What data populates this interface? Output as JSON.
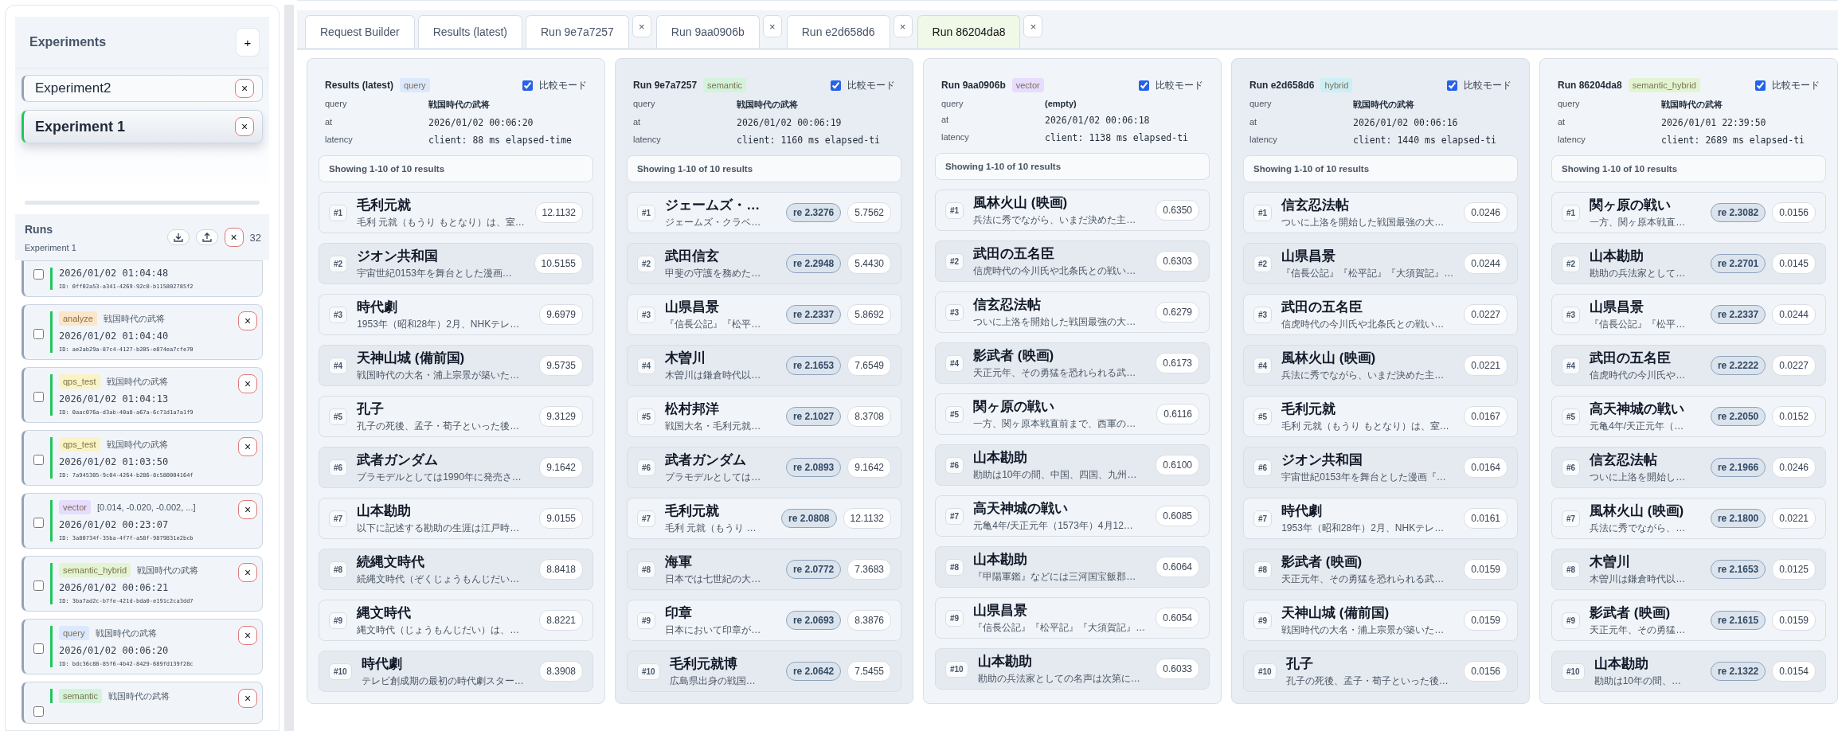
{
  "sidebar": {
    "experiments": {
      "title": "Experiments",
      "add": "+",
      "items": [
        {
          "name": "Experiment2",
          "selected": false,
          "close": "×"
        },
        {
          "name": "Experiment 1",
          "selected": true,
          "close": "×"
        }
      ]
    },
    "runs": {
      "title": "Runs",
      "subtitle": "Experiment 1",
      "close": "×",
      "count": "32",
      "items": [
        {
          "checked": false,
          "date": "2026/01/02 01:04:48",
          "id": "ID: 0ff02a53-a341-4269-92c0-b115802785f2"
        },
        {
          "checked": false,
          "tag": {
            "label": "analyze",
            "color": "#fce5c8"
          },
          "query": "戦国時代の武将",
          "date": "2026/01/02 01:04:40",
          "id": "ID: ae2ab29a-87c4-4127-b205-e874ea7cfe70",
          "close": "×"
        },
        {
          "checked": false,
          "tag": {
            "label": "qps_test",
            "color": "#f9f3c5"
          },
          "query": "戦国時代の武将",
          "date": "2026/01/02 01:04:13",
          "id": "ID: 0aac076a-d3ab-40a8-a67a-6c71d1a7a1f9",
          "close": "×"
        },
        {
          "checked": false,
          "tag": {
            "label": "qps_test",
            "color": "#f9f3c5"
          },
          "query": "戦国時代の武将",
          "date": "2026/01/02 01:03:50",
          "id": "ID: 7a945305-9c04-4264-b286-8c580004164f",
          "close": "×"
        },
        {
          "checked": false,
          "tag": {
            "label": "vector",
            "color": "#e6dcfd"
          },
          "query": "[0.014, -0.020, -0.002, ...]",
          "date": "2026/01/02 00:23:07",
          "id": "ID: 3a80734f-35ba-4f7f-a58f-9879831e2bcb",
          "close": "×"
        },
        {
          "checked": false,
          "tag": {
            "label": "semantic_hybrid",
            "color": "#e3f4d3"
          },
          "query": "戦国時代の武将",
          "date": "2026/01/02 00:06:21",
          "id": "ID: 3ba7ad2c-b7fe-421d-bda0-e191c2ca3dd7",
          "close": "×"
        },
        {
          "checked": false,
          "tag": {
            "label": "query",
            "color": "#dce8fd"
          },
          "query": "戦国時代の武将",
          "date": "2026/01/02 00:06:20",
          "id": "ID: bdc36c88-85f6-4b42-8429-689fd139f28c",
          "close": "×"
        },
        {
          "checked": false,
          "tag": {
            "label": "semantic",
            "color": "#d4f2dc"
          },
          "query": "戦国時代の武将",
          "close": "×"
        }
      ]
    }
  },
  "tabs": [
    {
      "label": "Request Builder",
      "selected": false
    },
    {
      "label": "Results (latest)",
      "selected": false
    },
    {
      "label": "Run 9e7a7257",
      "selected": false,
      "close": "×"
    },
    {
      "label": "Run 9aa0906b",
      "selected": false,
      "close": "×"
    },
    {
      "label": "Run e2d658d6",
      "selected": false,
      "close": "×"
    },
    {
      "label": "Run 86204da8",
      "selected": true,
      "close": "×"
    }
  ],
  "panels": [
    {
      "title": "Results (latest)",
      "tag": {
        "label": "query",
        "color": "#dce8fd"
      },
      "compare": {
        "label": "比較モード",
        "checked": true
      },
      "fields": [
        {
          "label": "query",
          "value": "戦国時代の武将",
          "kind": "text"
        },
        {
          "label": "at",
          "value": "2026/01/02 00:06:20",
          "kind": "mono"
        },
        {
          "label": "latency",
          "value": "client: 88 ms  elapsed-time",
          "kind": "mono"
        }
      ],
      "summary": "Showing 1-10 of 10 results",
      "results": [
        {
          "rank": "#1",
          "title": "毛利元就",
          "snippet": "毛利 元就（もうり もとなり）は、室…",
          "score": "12.1132"
        },
        {
          "rank": "#2",
          "title": "ジオン共和国",
          "snippet": "宇宙世紀0153年を舞台とした漫画…",
          "score": "10.5155"
        },
        {
          "rank": "#3",
          "title": "時代劇",
          "snippet": "1953年（昭和28年）2月、NHKテレ…",
          "score": "9.6979"
        },
        {
          "rank": "#4",
          "title": "天神山城 (備前国)",
          "snippet": "戦国時代の大名・浦上宗景が築いた…",
          "score": "9.5735"
        },
        {
          "rank": "#5",
          "title": "孔子",
          "snippet": "孔子の死後、孟子・荀子といった後…",
          "score": "9.3129"
        },
        {
          "rank": "#6",
          "title": "武者ガンダム",
          "snippet": "プラモデルとしては1990年に発売さ…",
          "score": "9.1642"
        },
        {
          "rank": "#7",
          "title": "山本勘助",
          "snippet": "以下に記述する勘助の生涯は江戸時…",
          "score": "9.0155"
        },
        {
          "rank": "#8",
          "title": "続縄文時代",
          "snippet": "続縄文時代（ぞくじょうもんじだい…",
          "score": "8.8418"
        },
        {
          "rank": "#9",
          "title": "縄文時代",
          "snippet": "縄文時代（じょうもんじだい）は、…",
          "score": "8.8221"
        },
        {
          "rank": "#10",
          "title": "時代劇",
          "snippet": "テレビ創成期の最初の時代劇スター…",
          "score": "8.3908"
        }
      ]
    },
    {
      "title": "Run 9e7a7257",
      "tag": {
        "label": "semantic",
        "color": "#d4f2dc"
      },
      "compare": {
        "label": "比較モード",
        "checked": true
      },
      "fields": [
        {
          "label": "query",
          "value": "戦国時代の武将",
          "kind": "text"
        },
        {
          "label": "at",
          "value": "2026/01/02 00:06:19",
          "kind": "mono"
        },
        {
          "label": "latency",
          "value": "client: 1160 ms  elapsed-ti",
          "kind": "mono"
        }
      ],
      "summary": "Showing 1-10 of 10 results",
      "results": [
        {
          "rank": "#1",
          "title": "ジェームズ・…",
          "snippet": "ジェームズ・クラベ…",
          "rerank": "re 2.3276",
          "score": "5.7562"
        },
        {
          "rank": "#2",
          "title": "武田信玄",
          "snippet": "甲斐の守護を務めた…",
          "rerank": "re 2.2948",
          "score": "5.4430"
        },
        {
          "rank": "#3",
          "title": "山県昌景",
          "snippet": "『信長公記』『松平…",
          "rerank": "re 2.2337",
          "score": "5.8692"
        },
        {
          "rank": "#4",
          "title": "木曽川",
          "snippet": "木曽川は鎌倉時代以…",
          "rerank": "re 2.1653",
          "score": "7.6549"
        },
        {
          "rank": "#5",
          "title": "松村邦洋",
          "snippet": "戦国大名・毛利元就…",
          "rerank": "re 2.1027",
          "score": "8.3708"
        },
        {
          "rank": "#6",
          "title": "武者ガンダム",
          "snippet": "プラモデルとしては…",
          "rerank": "re 2.0893",
          "score": "9.1642"
        },
        {
          "rank": "#7",
          "title": "毛利元就",
          "snippet": "毛利 元就（もうり …",
          "rerank": "re 2.0808",
          "score": "12.1132"
        },
        {
          "rank": "#8",
          "title": "海軍",
          "snippet": "日本では七世紀の大…",
          "rerank": "re 2.0772",
          "score": "7.3683"
        },
        {
          "rank": "#9",
          "title": "印章",
          "snippet": "日本において印章が…",
          "rerank": "re 2.0693",
          "score": "8.3876"
        },
        {
          "rank": "#10",
          "title": "毛利元就博",
          "snippet": "広島県出身の戦国…",
          "rerank": "re 2.0642",
          "score": "7.5455"
        }
      ]
    },
    {
      "title": "Run 9aa0906b",
      "tag": {
        "label": "vector",
        "color": "#e6dcfd"
      },
      "compare": {
        "label": "比較モード",
        "checked": true
      },
      "fields": [
        {
          "label": "query",
          "value": "(empty)",
          "kind": "text"
        },
        {
          "label": "at",
          "value": "2026/01/02 00:06:18",
          "kind": "mono"
        },
        {
          "label": "latency",
          "value": "client: 1138 ms  elapsed-ti",
          "kind": "mono"
        }
      ],
      "summary": "Showing 1-10 of 10 results",
      "results": [
        {
          "rank": "#1",
          "title": "風林火山 (映画)",
          "snippet": "兵法に秀でながら、いまだ決めた主…",
          "score": "0.6350"
        },
        {
          "rank": "#2",
          "title": "武田の五名臣",
          "snippet": "信虎時代の今川氏や北条氏との戦い…",
          "score": "0.6303"
        },
        {
          "rank": "#3",
          "title": "信玄忍法帖",
          "snippet": "ついに上洛を開始した戦国最強の大…",
          "score": "0.6279"
        },
        {
          "rank": "#4",
          "title": "影武者 (映画)",
          "snippet": "天正元年、その勇猛を恐れられる武…",
          "score": "0.6173"
        },
        {
          "rank": "#5",
          "title": "関ヶ原の戦い",
          "snippet": "一方、関ヶ原本戦直前まで、西軍の…",
          "score": "0.6116"
        },
        {
          "rank": "#6",
          "title": "山本勘助",
          "snippet": "勘助は10年の間、中国、四国、九州…",
          "score": "0.6100"
        },
        {
          "rank": "#7",
          "title": "高天神城の戦い",
          "snippet": "元亀4年/天正元年（1573年）4月12…",
          "score": "0.6085"
        },
        {
          "rank": "#8",
          "title": "山本勘助",
          "snippet": "『甲陽軍鑑』などには三河国宝飯郡…",
          "score": "0.6064"
        },
        {
          "rank": "#9",
          "title": "山県昌景",
          "snippet": "『信長公記』『松平記』『大須賀記』…",
          "score": "0.6054"
        },
        {
          "rank": "#10",
          "title": "山本勘助",
          "snippet": "勘助の兵法家としての名声は次第に…",
          "score": "0.6033"
        }
      ]
    },
    {
      "title": "Run e2d658d6",
      "tag": {
        "label": "hybrid",
        "color": "#cdeef5"
      },
      "compare": {
        "label": "比較モード",
        "checked": true
      },
      "fields": [
        {
          "label": "query",
          "value": "戦国時代の武将",
          "kind": "text"
        },
        {
          "label": "at",
          "value": "2026/01/02 00:06:16",
          "kind": "mono"
        },
        {
          "label": "latency",
          "value": "client: 1440 ms  elapsed-ti",
          "kind": "mono"
        }
      ],
      "summary": "Showing 1-10 of 10 results",
      "results": [
        {
          "rank": "#1",
          "title": "信玄忍法帖",
          "snippet": "ついに上洛を開始した戦国最強の大…",
          "score": "0.0246"
        },
        {
          "rank": "#2",
          "title": "山県昌景",
          "snippet": "『信長公記』『松平記』『大須賀記』…",
          "score": "0.0244"
        },
        {
          "rank": "#3",
          "title": "武田の五名臣",
          "snippet": "信虎時代の今川氏や北条氏との戦い…",
          "score": "0.0227"
        },
        {
          "rank": "#4",
          "title": "風林火山 (映画)",
          "snippet": "兵法に秀でながら、いまだ決めた主…",
          "score": "0.0221"
        },
        {
          "rank": "#5",
          "title": "毛利元就",
          "snippet": "毛利 元就（もうり もとなり）は、室…",
          "score": "0.0167"
        },
        {
          "rank": "#6",
          "title": "ジオン共和国",
          "snippet": "宇宙世紀0153年を舞台とした漫画『…",
          "score": "0.0164"
        },
        {
          "rank": "#7",
          "title": "時代劇",
          "snippet": "1953年（昭和28年）2月、NHKテレ…",
          "score": "0.0161"
        },
        {
          "rank": "#8",
          "title": "影武者 (映画)",
          "snippet": "天正元年、その勇猛を恐れられる武…",
          "score": "0.0159"
        },
        {
          "rank": "#9",
          "title": "天神山城 (備前国)",
          "snippet": "戦国時代の大名・浦上宗景が築いた…",
          "score": "0.0159"
        },
        {
          "rank": "#10",
          "title": "孔子",
          "snippet": "孔子の死後、孟子・荀子といった後…",
          "score": "0.0156"
        }
      ]
    },
    {
      "title": "Run 86204da8",
      "tag": {
        "label": "semantic_hybrid",
        "color": "#e3f4d3"
      },
      "compare": {
        "label": "比較モード",
        "checked": true
      },
      "fields": [
        {
          "label": "query",
          "value": "戦国時代の武将",
          "kind": "text"
        },
        {
          "label": "at",
          "value": "2026/01/01 22:39:50",
          "kind": "mono"
        },
        {
          "label": "latency",
          "value": "client: 2689 ms  elapsed-ti",
          "kind": "mono"
        }
      ],
      "summary": "Showing 1-10 of 10 results",
      "results": [
        {
          "rank": "#1",
          "title": "関ヶ原の戦い",
          "snippet": "一方、関ヶ原本戦直…",
          "rerank": "re 2.3082",
          "score": "0.0156"
        },
        {
          "rank": "#2",
          "title": "山本勘助",
          "snippet": "勘助の兵法家として…",
          "rerank": "re 2.2701",
          "score": "0.0145"
        },
        {
          "rank": "#3",
          "title": "山県昌景",
          "snippet": "『信長公記』『松平…",
          "rerank": "re 2.2337",
          "score": "0.0244"
        },
        {
          "rank": "#4",
          "title": "武田の五名臣",
          "snippet": "信虎時代の今川氏や…",
          "rerank": "re 2.2222",
          "score": "0.0227"
        },
        {
          "rank": "#5",
          "title": "高天神城の戦い",
          "snippet": "元亀4年/天正元年（…",
          "rerank": "re 2.2050",
          "score": "0.0152"
        },
        {
          "rank": "#6",
          "title": "信玄忍法帖",
          "snippet": "ついに上洛を開始し…",
          "rerank": "re 2.1966",
          "score": "0.0246"
        },
        {
          "rank": "#7",
          "title": "風林火山 (映画)",
          "snippet": "兵法に秀でながら、…",
          "rerank": "re 2.1800",
          "score": "0.0221"
        },
        {
          "rank": "#8",
          "title": "木曽川",
          "snippet": "木曽川は鎌倉時代以…",
          "rerank": "re 2.1653",
          "score": "0.0125"
        },
        {
          "rank": "#9",
          "title": "影武者 (映画)",
          "snippet": "天正元年、その勇猛…",
          "rerank": "re 2.1615",
          "score": "0.0159"
        },
        {
          "rank": "#10",
          "title": "山本勘助",
          "snippet": "勘助は10年の間、…",
          "rerank": "re 2.1322",
          "score": "0.0154"
        }
      ]
    }
  ]
}
